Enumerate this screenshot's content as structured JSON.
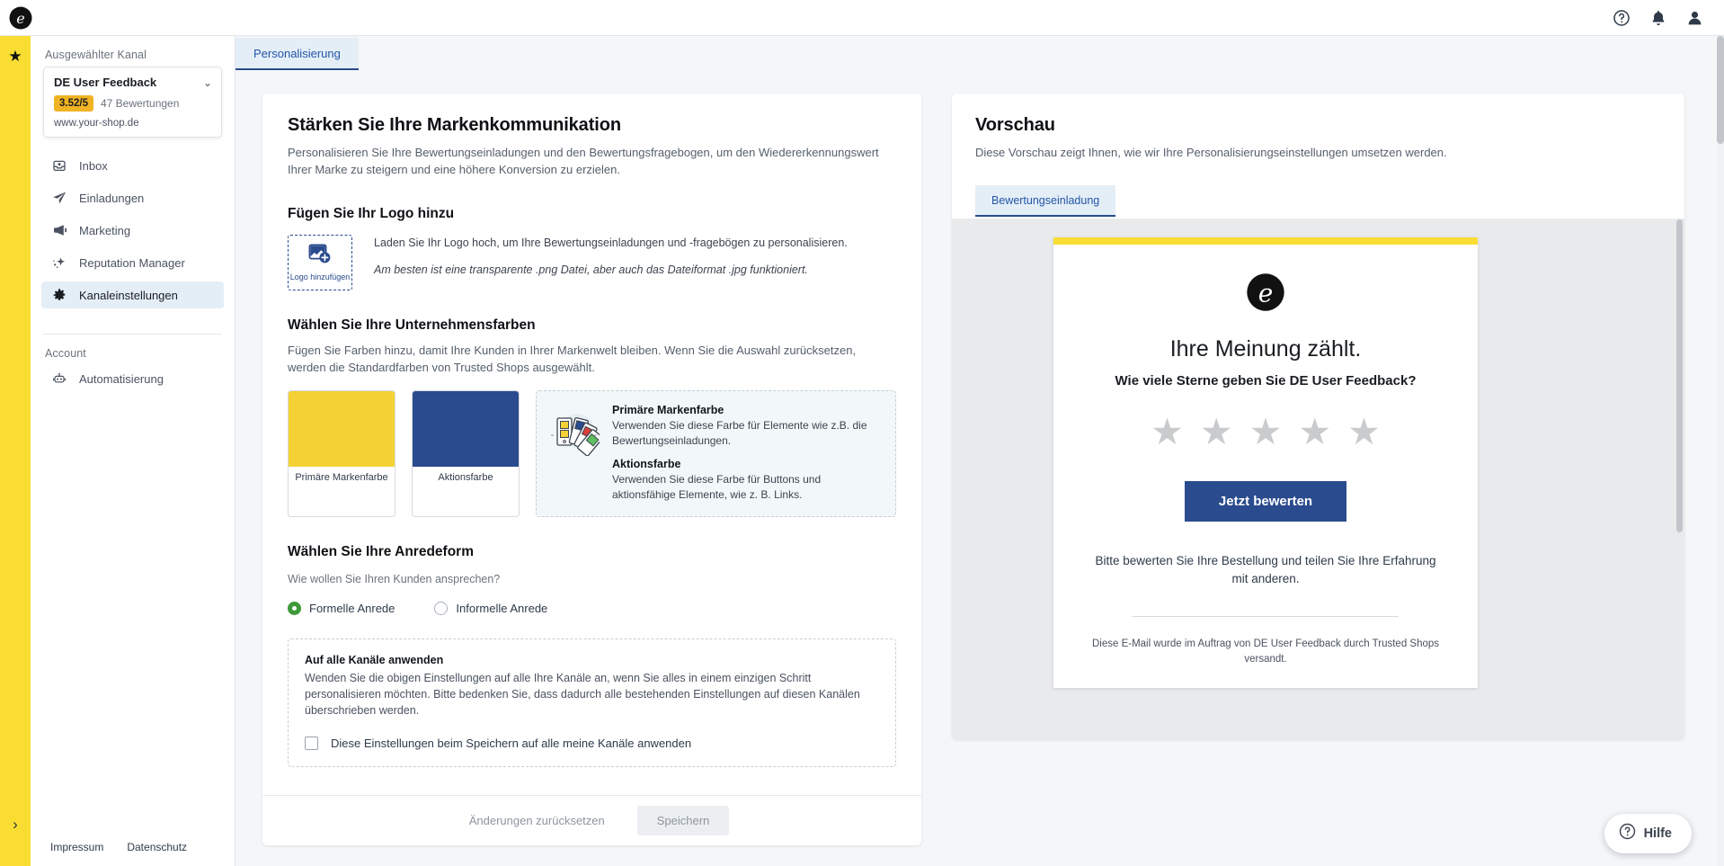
{
  "topbar": {
    "logo_icon": "trustedshops-e-logo",
    "icons": [
      {
        "name": "help-icon",
        "glyph": "?"
      },
      {
        "name": "notifications-bell-icon",
        "glyph": "bell"
      },
      {
        "name": "user-account-icon",
        "glyph": "user"
      }
    ]
  },
  "rail": {
    "star_icon": "★",
    "expand_icon": "›"
  },
  "sidebar": {
    "channel_label": "Ausgewählter Kanal",
    "channel": {
      "name": "DE User Feedback",
      "rating": "3.52/5",
      "review_count": "47 Bewertungen",
      "url": "www.your-shop.de",
      "chevron": "⌄"
    },
    "nav_items": [
      {
        "label": "Inbox",
        "icon": "inbox-icon",
        "active": false
      },
      {
        "label": "Einladungen",
        "icon": "paper-plane-icon",
        "active": false
      },
      {
        "label": "Marketing",
        "icon": "megaphone-icon",
        "active": false
      },
      {
        "label": "Reputation Manager",
        "icon": "sparkle-star-icon",
        "active": false
      },
      {
        "label": "Kanaleinstellungen",
        "icon": "gear-icon",
        "active": true
      }
    ],
    "account_label": "Account",
    "account_items": [
      {
        "label": "Automatisierung",
        "icon": "robot-icon"
      }
    ],
    "footer_links": [
      "Impressum",
      "Datenschutz"
    ]
  },
  "tabs": [
    {
      "label": "Personalisierung",
      "active": true
    }
  ],
  "personalization": {
    "title": "Stärken Sie Ihre Markenkommunikation",
    "subtitle": "Personalisieren Sie Ihre Bewertungseinladungen und den Bewertungsfragebogen, um den Wiedererkennungswert Ihrer Marke zu steigern und eine höhere Konversion zu erzielen.",
    "logo": {
      "heading": "Fügen Sie Ihr Logo hinzu",
      "drop_label": "Logo hinzufügen",
      "drop_icon": "image-add-icon",
      "text": "Laden Sie Ihr Logo hoch, um Ihre Bewertungseinladungen und -fragebögen zu personalisieren.",
      "hint": "Am besten ist eine transparente .png Datei, aber auch das Dateiformat .jpg funktioniert."
    },
    "colors": {
      "heading": "Wählen Sie Ihre Unternehmensfarben",
      "text": "Fügen Sie Farben hinzu, damit Ihre Kunden in Ihrer Markenwelt bleiben. Wenn Sie die Auswahl zurücksetzen, werden die Standardfarben von Trusted Shops ausgewählt.",
      "swatches": [
        {
          "label": "Primäre Markenfarbe",
          "hex": "#f4d235"
        },
        {
          "label": "Aktionsfarbe",
          "hex": "#2a4b8d"
        }
      ],
      "info_icon": "color-palette-fan-icon",
      "info": [
        {
          "title": "Primäre Markenfarbe",
          "body": "Verwenden Sie diese Farbe für Elemente wie z.B. die Bewertungseinladungen."
        },
        {
          "title": "Aktionsfarbe",
          "body": "Verwenden Sie diese Farbe für Buttons und aktionsfähige Elemente, wie z. B. Links."
        }
      ]
    },
    "salutation": {
      "heading": "Wählen Sie Ihre Anredeform",
      "question": "Wie wollen Sie Ihren Kunden ansprechen?",
      "options": [
        {
          "label": "Formelle Anrede",
          "selected": true
        },
        {
          "label": "Informelle Anrede",
          "selected": false
        }
      ]
    },
    "apply_all": {
      "title": "Auf alle Kanäle anwenden",
      "body": "Wenden Sie die obigen Einstellungen auf alle Ihre Kanäle an, wenn Sie alles in einem einzigen Schritt personalisieren möchten. Bitte bedenken Sie, dass dadurch alle bestehenden Einstellungen auf diesen Kanälen überschrieben werden.",
      "checkbox_label": "Diese Einstellungen beim Speichern auf alle meine Kanäle anwenden",
      "checked": false
    },
    "actions": {
      "reset_label": "Änderungen zurücksetzen",
      "save_label": "Speichern"
    }
  },
  "preview": {
    "title": "Vorschau",
    "subtitle": "Diese Vorschau zeigt Ihnen, wie wir Ihre Personalisierungseinstellungen umsetzen werden.",
    "tabs": [
      {
        "label": "Bewertungseinladung",
        "active": true
      }
    ],
    "email": {
      "accent_hex": "#f9dd33",
      "logo_icon": "trustedshops-e-logo",
      "headline": "Ihre Meinung zählt.",
      "subheadline": "Wie viele Sterne geben Sie DE User Feedback?",
      "stars": [
        "★",
        "★",
        "★",
        "★",
        "★"
      ],
      "cta_label": "Jetzt bewerten",
      "cta_hex": "#2a4b8d",
      "paragraph": "Bitte bewerten Sie Ihre Bestellung und teilen Sie Ihre Erfahrung mit anderen.",
      "footer": "Diese E-Mail wurde im Auftrag von DE User Feedback durch Trusted Shops versandt."
    }
  },
  "help_widget": {
    "label": "Hilfe",
    "icon": "question-circle-icon"
  }
}
